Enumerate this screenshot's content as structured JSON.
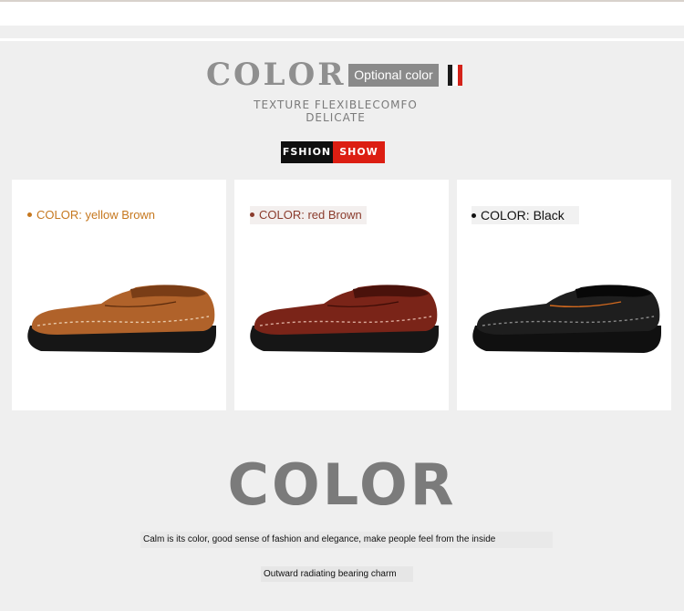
{
  "header": {
    "title": "COLOR",
    "optional_label": "Optional color",
    "subtitle_line1": "TEXTURE FLEXIBLECOMFO",
    "subtitle_line2": "DELICATE",
    "fashion_left": "FSHION",
    "fashion_right": "SHOW",
    "flag_colors": [
      "#1a1a1a",
      "#ffffff",
      "#d4231a"
    ]
  },
  "products": [
    {
      "label": "COLOR: yellow Brown",
      "label_color": "#c6781f",
      "label_bg": "#ffffff",
      "upper_color": "#b0622a",
      "upper_dark": "#7a3d16",
      "sole_color": "#161616"
    },
    {
      "label": "COLOR: red Brown",
      "label_color": "#8a3b2c",
      "label_bg": "#f3efee",
      "upper_color": "#7a2418",
      "upper_dark": "#4a120b",
      "sole_color": "#161616"
    },
    {
      "label": "COLOR: Black",
      "label_color": "#111111",
      "label_bg": "#f1f1f1",
      "upper_color": "#1e1e1e",
      "upper_dark": "#080808",
      "sole_color": "#101010"
    }
  ],
  "section": {
    "big_title": "COLOR",
    "description": "Calm is its color, good sense of fashion and elegance, make people feel from the inside",
    "tagline": "Outward radiating bearing charm"
  }
}
